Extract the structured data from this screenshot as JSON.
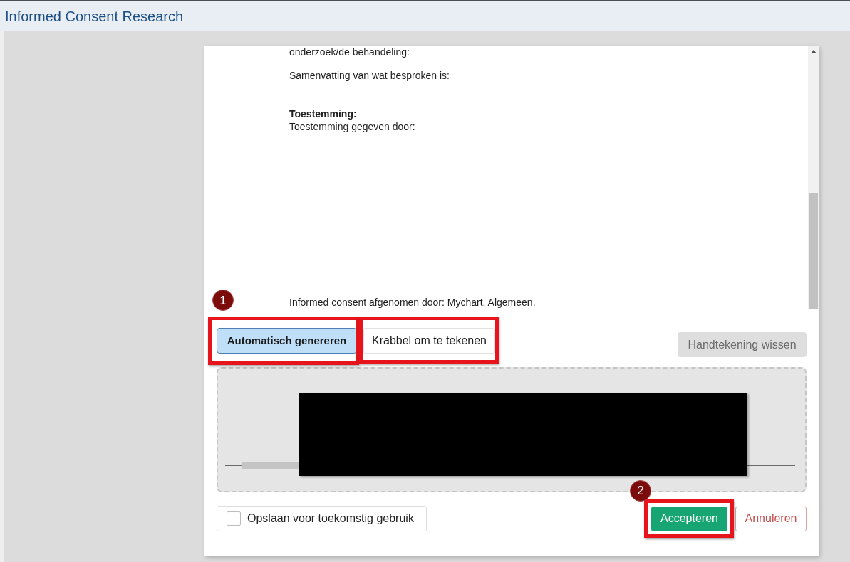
{
  "header": {
    "title": "Informed Consent Research"
  },
  "document": {
    "lines": [
      {
        "kind": "line",
        "text": "onderzoek/de behandeling:"
      },
      {
        "kind": "paragraph",
        "text": "Samenvatting van wat besproken is:"
      },
      {
        "kind": "heading",
        "text": "Toestemming:"
      },
      {
        "kind": "line",
        "text": "Toestemming gegeven door:"
      },
      {
        "kind": "signoff",
        "text": "Informed consent afgenomen door: Mychart, Algemeen."
      }
    ]
  },
  "signature": {
    "step_marker": "1",
    "modes": [
      {
        "label": "Automatisch genereren",
        "selected": true,
        "highlighted": true
      },
      {
        "label": "Krabbel om te tekenen",
        "selected": false,
        "highlighted": true
      }
    ],
    "clear_button": {
      "label": "Handtekening wissen",
      "disabled": true
    }
  },
  "save_option": {
    "label": "Opslaan voor toekomstig gebruik",
    "checked": false
  },
  "actions": [
    {
      "label": "Accepteren",
      "kind": "primary",
      "highlighted": true,
      "step_marker": "2"
    },
    {
      "label": "Annuleren",
      "kind": "secondary",
      "highlighted": false
    }
  ]
}
